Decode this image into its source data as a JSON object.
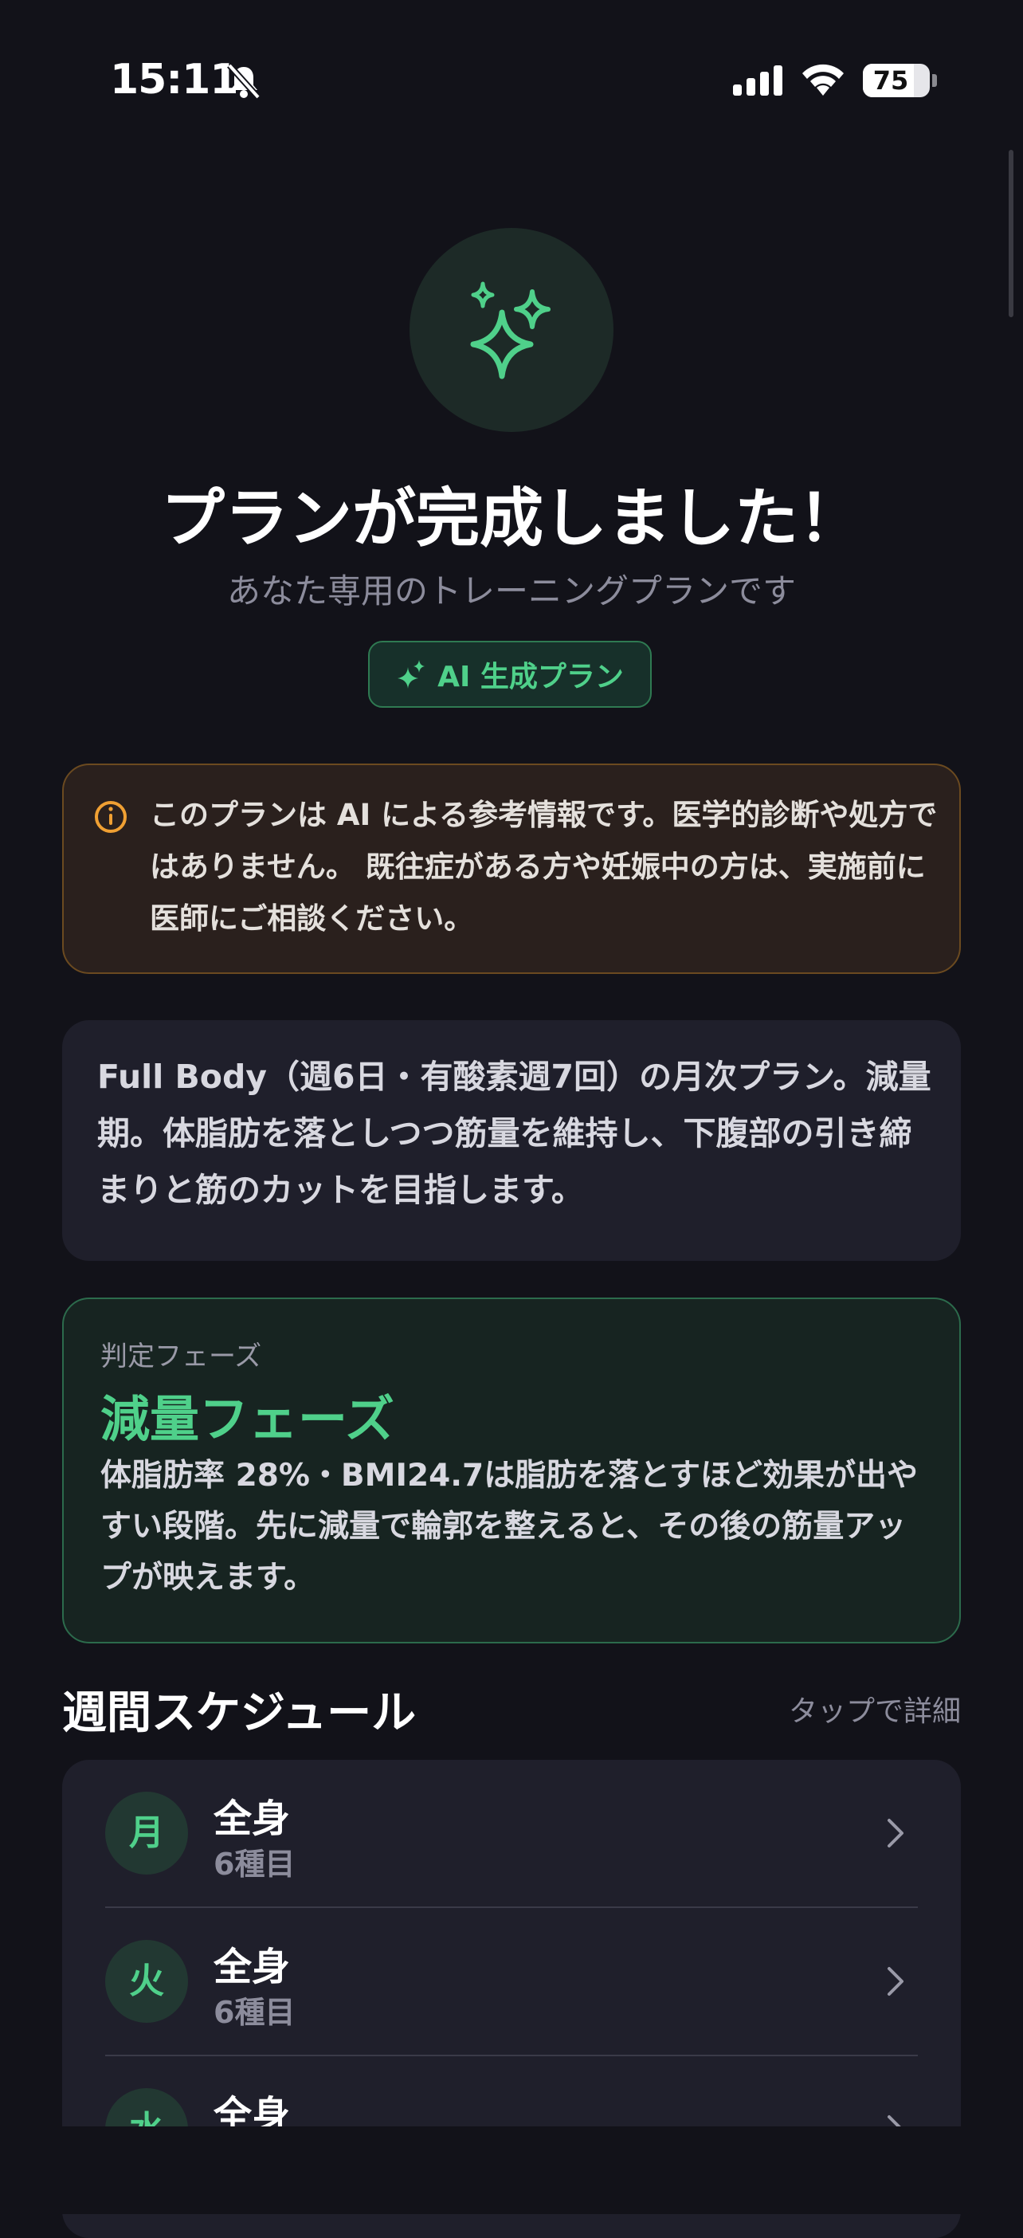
{
  "status_bar": {
    "time": "15:11",
    "battery": "75"
  },
  "hero": {
    "icon": "sparkles-icon"
  },
  "header": {
    "title": "プランが完成しました！",
    "subtitle": "あなた専用のトレーニングプランです",
    "badge": "AI 生成プラン"
  },
  "disclaimer": {
    "text": "このプランは AI による参考情報です。医学的診断や処方ではありません。 既往症がある方や妊娠中の方は、実施前に医師にご相談ください。"
  },
  "summary": {
    "text": "Full Body（週6日・有酸素週7回）の月次プラン。減量期。体脂肪を落としつつ筋量を維持し、下腹部の引き締まりと筋のカットを目指します。"
  },
  "phase": {
    "label": "判定フェーズ",
    "title": "減量フェーズ",
    "description": "体脂肪率 28%・BMI24.7は脂肪を落とすほど効果が出やすい段階。先に減量で輪郭を整えると、その後の筋量アップが映えます。"
  },
  "schedule": {
    "title": "週間スケジュール",
    "hint": "タップで詳細",
    "days": [
      {
        "day": "月",
        "title": "全身",
        "count": "6種目"
      },
      {
        "day": "火",
        "title": "全身",
        "count": "6種目"
      },
      {
        "day": "水",
        "title": "全身",
        "count": ""
      }
    ]
  },
  "colors": {
    "accent": "#4fd08a",
    "background": "#121219",
    "card": "#1f1f2b",
    "warning": "#f0a033"
  }
}
